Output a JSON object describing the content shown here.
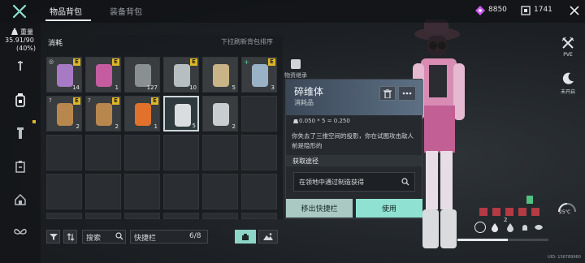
{
  "header": {
    "tabs": [
      {
        "label": "物品背包"
      },
      {
        "label": "装备背包"
      }
    ],
    "currency_1": "8850",
    "currency_2": "1741"
  },
  "sidebar": {
    "weight_label": "重量",
    "weight_value": "35.91/90",
    "weight_percent": "(40%)"
  },
  "inventory": {
    "section_title": "消耗",
    "sort_hint": "下拉刷新背包排序",
    "slots": [
      {
        "name": "canned-food",
        "qty": "14",
        "badge": "E",
        "corner": "◎"
      },
      {
        "name": "pink-bottle",
        "qty": "1",
        "badge": "E",
        "corner": ""
      },
      {
        "name": "glass-jar",
        "qty": "127",
        "badge": "",
        "corner": ""
      },
      {
        "name": "spray-can",
        "qty": "10",
        "badge": "E",
        "corner": ""
      },
      {
        "name": "bread-loaf",
        "qty": "5",
        "badge": "",
        "corner": ""
      },
      {
        "name": "syringe",
        "qty": "3",
        "badge": "E",
        "corner": "+"
      },
      {
        "name": "sardine-tin",
        "qty": "2",
        "badge": "E",
        "corner": "?"
      },
      {
        "name": "sardine-tin-2",
        "qty": "2",
        "badge": "E",
        "corner": "?"
      },
      {
        "name": "orange-canister",
        "qty": "1",
        "badge": "E",
        "corner": ""
      },
      {
        "name": "crystal-canister",
        "qty": "5",
        "badge": "",
        "corner": ""
      },
      {
        "name": "grey-canister",
        "qty": "2",
        "badge": "",
        "corner": ""
      }
    ]
  },
  "toolbar": {
    "search_label": "搜索",
    "quickbar_label": "快捷栏",
    "quickbar_count": "6/8"
  },
  "detail": {
    "inherit_label": "物资继承",
    "item_name": "碎维体",
    "item_type": "消耗品",
    "weight_formula": "0.050 * 5 = 0.250",
    "description": "你失去了三维空间的投影，你在试图攻击敌人前是隐形的",
    "source_title": "获取途径",
    "source_text": "在领地中通过制造获得",
    "remove_button": "移出快捷栏",
    "use_button": "使用"
  },
  "right_panel": {
    "pve_label": "PVE",
    "notopen_label": "未开启",
    "temperature": "25℃",
    "status_count": "2",
    "uid": "UID: 156789960"
  },
  "colors": {
    "accent_teal": "#8fe2d2",
    "badge_yellow": "#e0b726",
    "currency_purple": "#c75be8"
  }
}
